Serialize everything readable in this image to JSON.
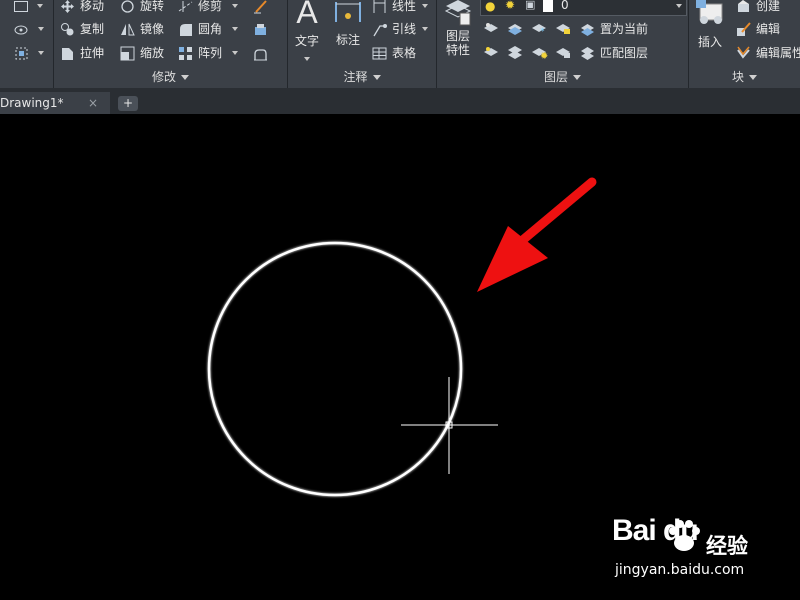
{
  "ribbon": {
    "modify": {
      "title": "修改",
      "move": "移动",
      "rotate": "旋转",
      "trim": "修剪",
      "copy": "复制",
      "mirror": "镜像",
      "fillet": "圆角",
      "stretch": "拉伸",
      "scale": "缩放",
      "array": "阵列"
    },
    "annotation": {
      "title": "注释",
      "text": "文字",
      "dimension": "标注",
      "linetype": "线性",
      "leader": "引线",
      "table": "表格"
    },
    "layers": {
      "title": "图层",
      "properties_line1": "图层",
      "properties_line2": "特性",
      "current_layer": "0",
      "set_current": "置为当前",
      "match_layer": "匹配图层"
    },
    "block": {
      "title": "块",
      "insert": "插入",
      "create": "创建",
      "edit": "编辑",
      "edit_attributes": "编辑属性"
    }
  },
  "tabs": {
    "drawing": "Drawing1*",
    "close": "×",
    "new": "+"
  },
  "watermark": {
    "logo": "Bai du",
    "brand": "经验",
    "url": "jingyan.baidu.com"
  },
  "colors": {
    "ribbon_bg": "#3b4047",
    "canvas_bg": "#000000",
    "arrow": "#ee1111",
    "circle": "#ffffff"
  },
  "icons": [
    "move-icon",
    "rotate-icon",
    "trim-icon",
    "copy-icon",
    "mirror-icon",
    "fillet-icon",
    "stretch-icon",
    "scale-icon",
    "array-icon",
    "text-icon",
    "dimension-icon",
    "layer-properties-icon",
    "insert-block-icon",
    "lightbulb-icon",
    "paw-icon"
  ]
}
